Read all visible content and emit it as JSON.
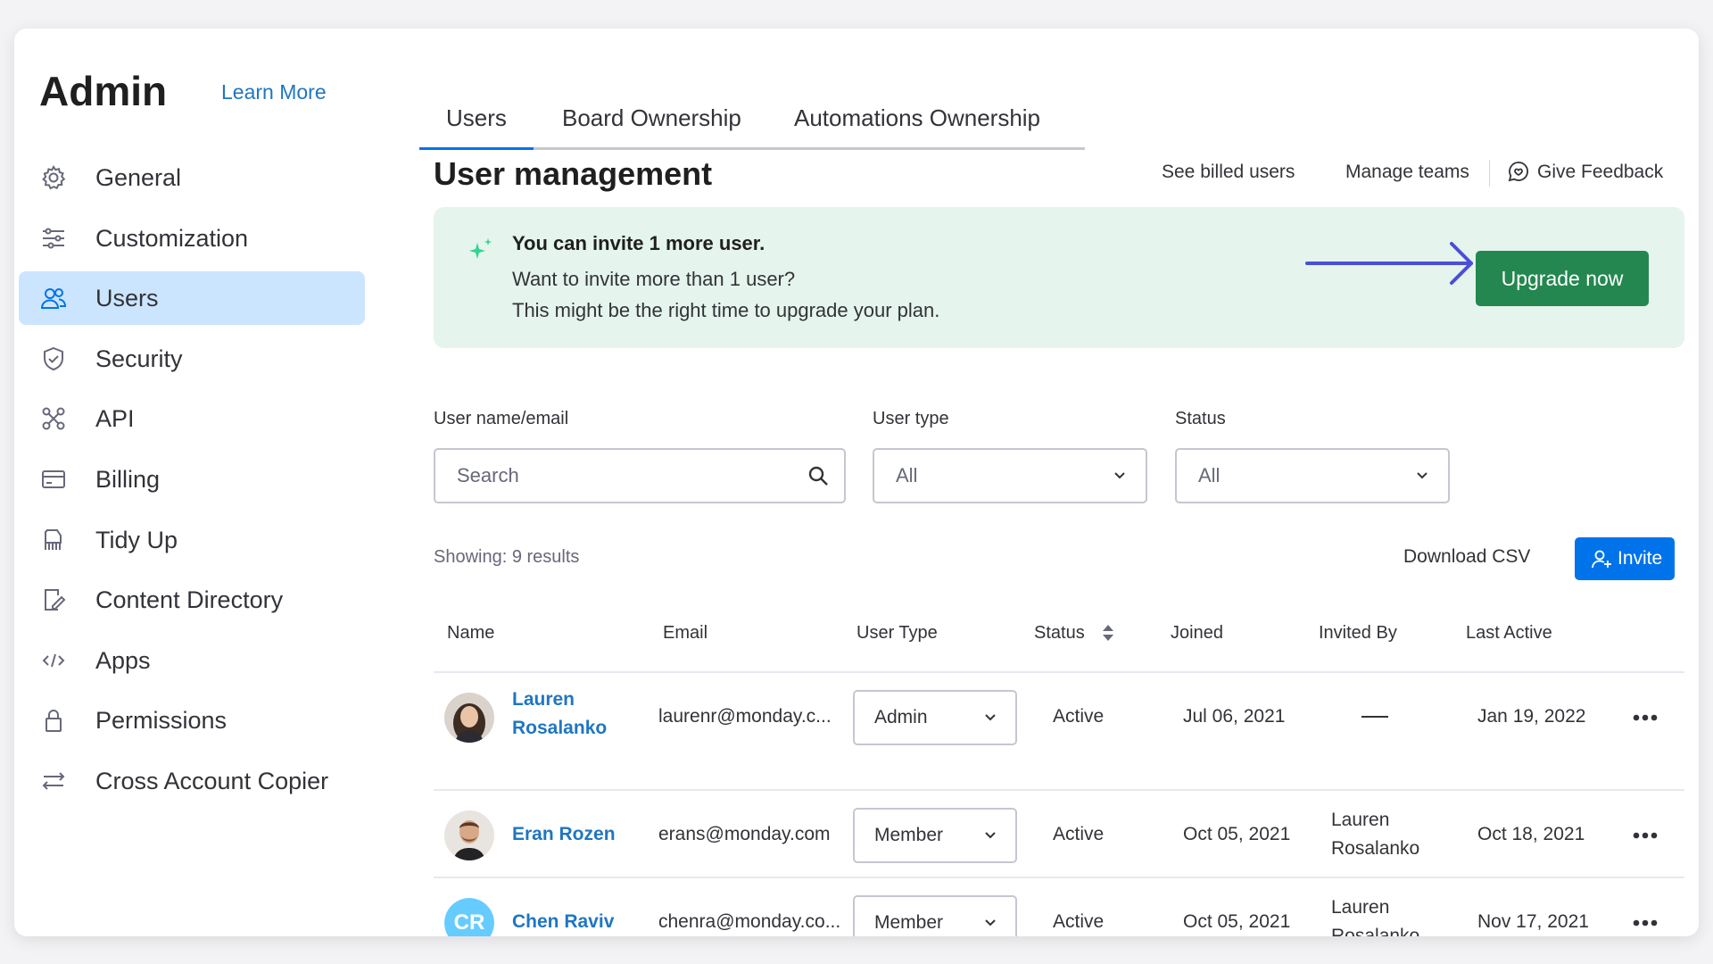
{
  "sidebar": {
    "title": "Admin",
    "learn_more": "Learn More",
    "items": [
      {
        "label": "General",
        "icon": "gear-icon"
      },
      {
        "label": "Customization",
        "icon": "sliders-icon"
      },
      {
        "label": "Users",
        "icon": "users-icon",
        "active": true
      },
      {
        "label": "Security",
        "icon": "shield-icon"
      },
      {
        "label": "API",
        "icon": "api-icon"
      },
      {
        "label": "Billing",
        "icon": "credit-card-icon"
      },
      {
        "label": "Tidy Up",
        "icon": "broom-icon"
      },
      {
        "label": "Content Directory",
        "icon": "document-edit-icon"
      },
      {
        "label": "Apps",
        "icon": "code-icon"
      },
      {
        "label": "Permissions",
        "icon": "lock-icon"
      },
      {
        "label": "Cross Account Copier",
        "icon": "transfer-arrows-icon"
      }
    ]
  },
  "tabs": [
    {
      "label": "Users",
      "active": true
    },
    {
      "label": "Board Ownership"
    },
    {
      "label": "Automations Ownership"
    }
  ],
  "header": {
    "title": "User management",
    "see_billed_users": "See billed users",
    "manage_teams": "Manage teams",
    "give_feedback": "Give Feedback"
  },
  "banner": {
    "title": "You can invite 1 more user.",
    "line1": "Want to invite more than 1 user?",
    "line2": "This might be the right time to upgrade your plan.",
    "button": "Upgrade now"
  },
  "filters": {
    "name_label": "User name/email",
    "name_placeholder": "Search",
    "type_label": "User type",
    "type_value": "All",
    "status_label": "Status",
    "status_value": "All"
  },
  "results": {
    "showing": "Showing: 9 results",
    "download_csv": "Download CSV",
    "invite": "Invite"
  },
  "table": {
    "columns": [
      "Name",
      "Email",
      "User Type",
      "Status",
      "Joined",
      "Invited By",
      "Last Active"
    ],
    "rows": [
      {
        "name_line1": "Lauren",
        "name_line2": "Rosalanko",
        "email": "laurenr@monday.c...",
        "user_type": "Admin",
        "status": "Active",
        "joined": "Jul 06, 2021",
        "invited_line1": "",
        "invited_line2": "",
        "last_active": "Jan 19, 2022"
      },
      {
        "name_line1": "Eran Rozen",
        "name_line2": "",
        "email": "erans@monday.com",
        "user_type": "Member",
        "status": "Active",
        "joined": "Oct 05, 2021",
        "invited_line1": "Lauren",
        "invited_line2": "Rosalanko",
        "last_active": "Oct 18, 2021"
      },
      {
        "name_line1": "Chen Raviv",
        "name_line2": "",
        "initials": "CR",
        "email": "chenra@monday.co...",
        "user_type": "Member",
        "status": "Active",
        "joined": "Oct 05, 2021",
        "invited_line1": "Lauren",
        "invited_line2": "Rosalanko",
        "last_active": "Nov 17, 2021"
      }
    ]
  },
  "colors": {
    "accent": "#0073ea",
    "active_nav": "#cce5ff",
    "banner_bg": "#e5f4ed",
    "upgrade_green": "#258750",
    "link_blue": "#1f76c2",
    "arrow": "#4b4ed6"
  }
}
